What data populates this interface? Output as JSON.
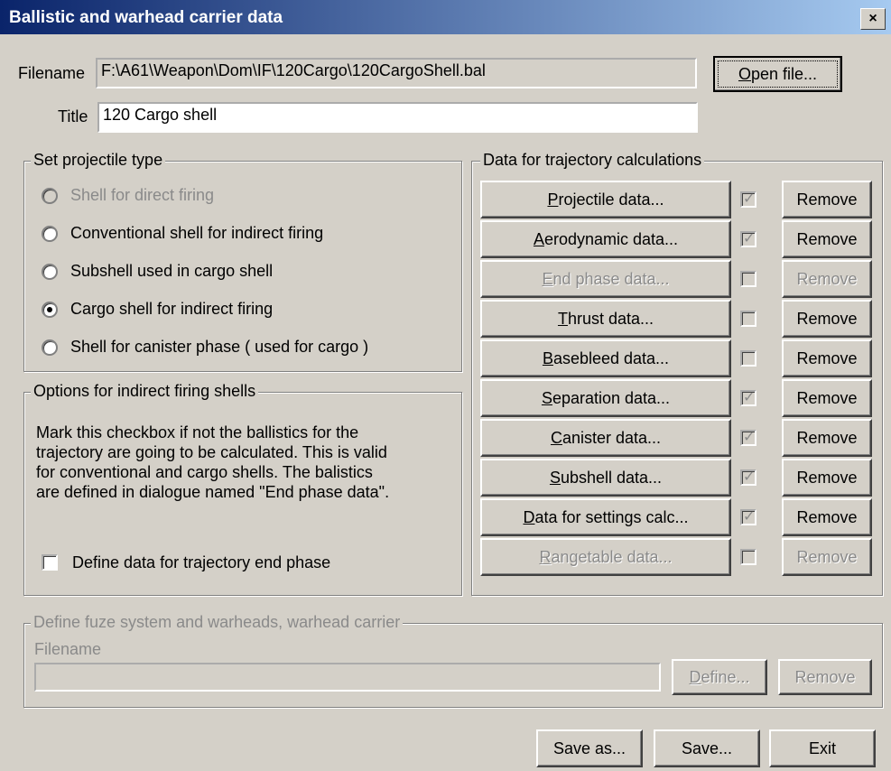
{
  "window": {
    "title": "Ballistic and warhead carrier data",
    "close": "×"
  },
  "file": {
    "label": "Filename",
    "path": "F:\\A61\\Weapon\\Dom\\IF\\120Cargo\\120CargoShell.bal",
    "open_btn": "Open file...",
    "open_btn_key": "O",
    "open_btn_rest": "pen file..."
  },
  "title_field": {
    "label": "Title",
    "value": "120 Cargo shell"
  },
  "projectile_type": {
    "legend": "Set projectile type",
    "options": [
      {
        "label": "Shell for direct firing",
        "selected": false,
        "enabled": false
      },
      {
        "label": "Conventional shell for indirect firing",
        "selected": false,
        "enabled": true
      },
      {
        "label": "Subshell used in cargo shell",
        "selected": false,
        "enabled": true
      },
      {
        "label": "Cargo shell for indirect firing",
        "selected": true,
        "enabled": true
      },
      {
        "label": "Shell for canister phase ( used for cargo )",
        "selected": false,
        "enabled": true
      }
    ]
  },
  "options": {
    "legend": "Options for indirect firing shells",
    "text1": "Mark this checkbox if not the ballistics for the",
    "text2": "trajectory are going to be calculated. This is valid",
    "text3": "for conventional and cargo shells. The balistics",
    "text4": "are defined in dialogue named \"End phase data\".",
    "checkbox_label": "Define data for trajectory end phase",
    "checked": false
  },
  "trajectory": {
    "legend": "Data for trajectory calculations",
    "remove_label": "Remove",
    "rows": [
      {
        "key": "P",
        "rest": "rojectile data...",
        "enabled": true,
        "checked": true,
        "remove_enabled": true
      },
      {
        "key": "A",
        "rest": "erodynamic data...",
        "enabled": true,
        "checked": true,
        "remove_enabled": true
      },
      {
        "key": "E",
        "rest": "nd phase data...",
        "enabled": false,
        "checked": false,
        "remove_enabled": false
      },
      {
        "key": "T",
        "rest": "hrust data...",
        "enabled": true,
        "checked": false,
        "remove_enabled": true
      },
      {
        "key": "B",
        "rest": "asebleed data...",
        "enabled": true,
        "checked": false,
        "remove_enabled": true
      },
      {
        "key": "S",
        "rest": "eparation data...",
        "enabled": true,
        "checked": true,
        "remove_enabled": true
      },
      {
        "key": "C",
        "rest": "anister data...",
        "enabled": true,
        "checked": true,
        "remove_enabled": true
      },
      {
        "key": "S",
        "rest": "ubshell data...",
        "enabled": true,
        "checked": true,
        "remove_enabled": true
      },
      {
        "key": "D",
        "rest": "ata for settings calc...",
        "enabled": true,
        "checked": true,
        "remove_enabled": true
      },
      {
        "key": "R",
        "rest": "angetable data...",
        "enabled": false,
        "checked": false,
        "remove_enabled": false
      }
    ]
  },
  "fuze": {
    "legend": "Define fuze system and warheads, warhead carrier",
    "filename_label": "Filename",
    "filename_value": "",
    "define_key": "D",
    "define_rest": "efine...",
    "remove": "Remove"
  },
  "footer": {
    "save_as": "Save as...",
    "save": "Save...",
    "exit": "Exit"
  }
}
